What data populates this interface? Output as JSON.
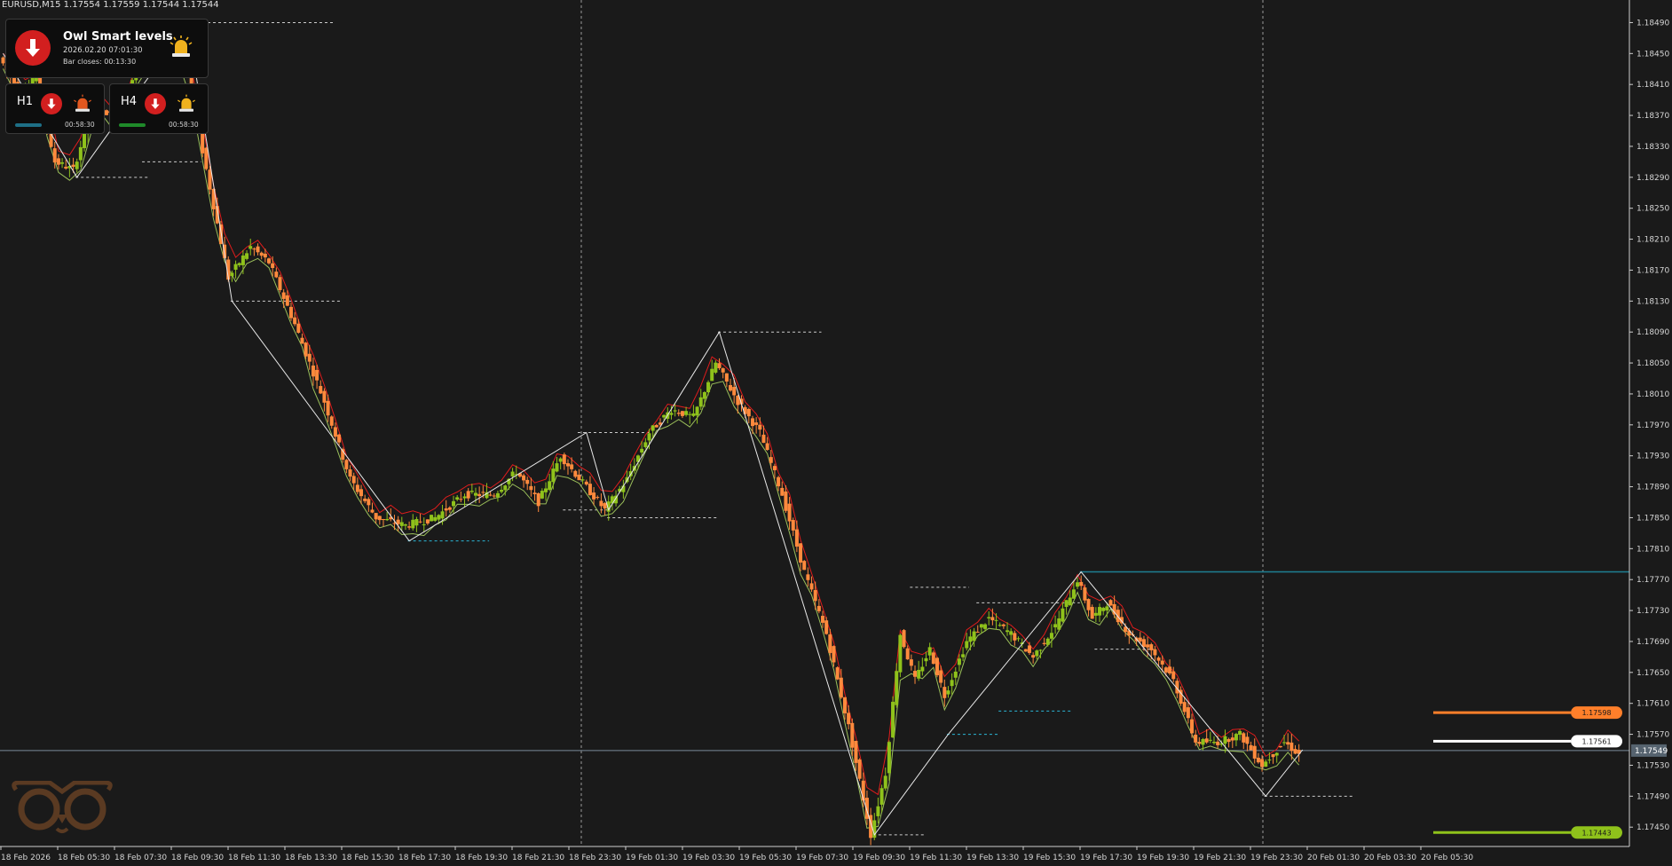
{
  "symbol_line": "EURUSD,M15  1.17554 1.17559 1.17544 1.17544",
  "panel": {
    "title": "Owl Smart levels",
    "datetime": "2026.02.20 07:01:30",
    "bar_closes": "Bar closes: 00:13:30",
    "direction": "down",
    "timeframes": [
      {
        "label": "H1",
        "timer": "00:58:30",
        "bar_color": "#1e6f86"
      },
      {
        "label": "H4",
        "timer": "00:58:30",
        "bar_color": "#1f8a2a"
      }
    ]
  },
  "colors": {
    "background": "#1a1a1a",
    "bull_candle": "#8fc21b",
    "bear_candle": "#ff8a3d",
    "zigzag": "#e8e8e8",
    "upper_envelope": "#e01c1c",
    "lower_envelope": "#9bbf5a",
    "level_dash": "#cccccc",
    "level_cyan": "#2bb6d6",
    "level_orange": "#ff7f2a",
    "level_white": "#ffffff",
    "level_green": "#8fc21b",
    "current_price": "#7a8a99"
  },
  "chart_data": {
    "type": "candlestick",
    "symbol": "EURUSD",
    "timeframe": "M15",
    "ylim": [
      1.17425,
      1.1851
    ],
    "y_ticks": [
      "1.18490",
      "1.18450",
      "1.18410",
      "1.18370",
      "1.18330",
      "1.18290",
      "1.18250",
      "1.18210",
      "1.18170",
      "1.18130",
      "1.18090",
      "1.18050",
      "1.18010",
      "1.17970",
      "1.17930",
      "1.17890",
      "1.17850",
      "1.17810",
      "1.17770",
      "1.17730",
      "1.17690",
      "1.17650",
      "1.17610",
      "1.17570",
      "1.17530",
      "1.17490",
      "1.17450"
    ],
    "x_ticks": [
      "18 Feb 2026",
      "18 Feb 05:30",
      "18 Feb 07:30",
      "18 Feb 09:30",
      "18 Feb 11:30",
      "18 Feb 13:30",
      "18 Feb 15:30",
      "18 Feb 17:30",
      "18 Feb 19:30",
      "18 Feb 21:30",
      "18 Feb 23:30",
      "19 Feb 01:30",
      "19 Feb 03:30",
      "19 Feb 05:30",
      "19 Feb 07:30",
      "19 Feb 09:30",
      "19 Feb 11:30",
      "19 Feb 13:30",
      "19 Feb 15:30",
      "19 Feb 17:30",
      "19 Feb 19:30",
      "19 Feb 21:30",
      "19 Feb 23:30",
      "20 Feb 01:30",
      "20 Feb 03:30",
      "20 Feb 05:30"
    ],
    "candles_per_tick": 8,
    "candle_count": 206,
    "current_price": 1.17549,
    "current_price_label": "1.17549",
    "price_path": [
      [
        0,
        1.18445
      ],
      [
        6,
        1.18395
      ],
      [
        10,
        1.1842
      ],
      [
        15,
        1.1831
      ],
      [
        20,
        1.183
      ],
      [
        26,
        1.1839
      ],
      [
        32,
        1.1836
      ],
      [
        38,
        1.1844
      ],
      [
        44,
        1.1847
      ],
      [
        50,
        1.18445
      ],
      [
        56,
        1.183
      ],
      [
        62,
        1.1816
      ],
      [
        68,
        1.182
      ],
      [
        73,
        1.1818
      ],
      [
        80,
        1.181
      ],
      [
        88,
        1.18
      ],
      [
        95,
        1.179
      ],
      [
        102,
        1.1785
      ],
      [
        110,
        1.1784
      ],
      [
        118,
        1.1785
      ],
      [
        126,
        1.1788
      ],
      [
        134,
        1.1788
      ],
      [
        140,
        1.1791
      ],
      [
        146,
        1.1787
      ],
      [
        152,
        1.1793
      ],
      [
        158,
        1.17895
      ],
      [
        164,
        1.1786
      ],
      [
        170,
        1.179
      ],
      [
        176,
        1.1796
      ],
      [
        182,
        1.1799
      ],
      [
        188,
        1.1798
      ],
      [
        194,
        1.1805
      ],
      [
        200,
        1.18
      ],
      [
        206,
        1.1796
      ],
      [
        212,
        1.1788
      ],
      [
        218,
        1.1778
      ],
      [
        224,
        1.177
      ],
      [
        230,
        1.1758
      ],
      [
        236,
        1.1744
      ],
      [
        240,
        1.1752
      ],
      [
        244,
        1.177
      ],
      [
        248,
        1.1764
      ],
      [
        252,
        1.1768
      ],
      [
        256,
        1.1762
      ],
      [
        262,
        1.1769
      ],
      [
        268,
        1.1772
      ],
      [
        274,
        1.177
      ],
      [
        280,
        1.1767
      ],
      [
        286,
        1.1771
      ],
      [
        292,
        1.1777
      ],
      [
        296,
        1.1772
      ],
      [
        300,
        1.1774
      ],
      [
        306,
        1.177
      ],
      [
        312,
        1.1768
      ],
      [
        318,
        1.1764
      ],
      [
        324,
        1.1756
      ],
      [
        330,
        1.1756
      ],
      [
        336,
        1.1757
      ],
      [
        342,
        1.1753
      ],
      [
        348,
        1.1756
      ],
      [
        352,
        1.17544
      ]
    ],
    "zigzag": [
      [
        1.1845,
        0
      ],
      [
        1.1829,
        20
      ],
      [
        1.1849,
        50
      ],
      [
        1.1813,
        62
      ],
      [
        1.1782,
        110
      ],
      [
        1.1796,
        158
      ],
      [
        1.1786,
        164
      ],
      [
        1.1809,
        194
      ],
      [
        1.1744,
        236
      ],
      [
        1.1757,
        256
      ],
      [
        1.1778,
        292
      ],
      [
        1.1749,
        342
      ],
      [
        1.1755,
        352
      ]
    ],
    "levels": [
      {
        "price": 1.1849,
        "x0": 50,
        "x1": 90,
        "style": "dash",
        "color": "#cccccc"
      },
      {
        "price": 1.1829,
        "x0": 20,
        "x1": 40,
        "style": "dash",
        "color": "#cccccc"
      },
      {
        "price": 1.1831,
        "x0": 38,
        "x1": 54,
        "style": "dash",
        "color": "#cccccc"
      },
      {
        "price": 1.1813,
        "x0": 62,
        "x1": 92,
        "style": "dash",
        "color": "#cccccc"
      },
      {
        "price": 1.1782,
        "x0": 110,
        "x1": 132,
        "style": "dash",
        "color": "#2bb6d6"
      },
      {
        "price": 1.1796,
        "x0": 156,
        "x1": 176,
        "style": "dash",
        "color": "#cccccc"
      },
      {
        "price": 1.1786,
        "x0": 152,
        "x1": 164,
        "style": "dash",
        "color": "#cccccc"
      },
      {
        "price": 1.1785,
        "x0": 164,
        "x1": 194,
        "style": "dash",
        "color": "#cccccc"
      },
      {
        "price": 1.1809,
        "x0": 194,
        "x1": 222,
        "style": "dash",
        "color": "#cccccc"
      },
      {
        "price": 1.1744,
        "x0": 236,
        "x1": 250,
        "style": "dash",
        "color": "#cccccc"
      },
      {
        "price": 1.1776,
        "x0": 246,
        "x1": 262,
        "style": "dash",
        "color": "#cccccc"
      },
      {
        "price": 1.1774,
        "x0": 264,
        "x1": 292,
        "style": "dash",
        "color": "#cccccc"
      },
      {
        "price": 1.1757,
        "x0": 256,
        "x1": 270,
        "style": "dash",
        "color": "#2bb6d6"
      },
      {
        "price": 1.176,
        "x0": 270,
        "x1": 290,
        "style": "dash",
        "color": "#2bb6d6"
      },
      {
        "price": 1.1768,
        "x0": 296,
        "x1": 312,
        "style": "dash",
        "color": "#cccccc"
      },
      {
        "price": 1.1749,
        "x0": 342,
        "x1": 366,
        "style": "dash",
        "color": "#cccccc"
      }
    ],
    "right_levels": [
      {
        "price": 1.17598,
        "label": "1.17598",
        "color": "#ff7f2a",
        "text_color": "#1a1a1a"
      },
      {
        "price": 1.17561,
        "label": "1.17561",
        "color": "#ffffff",
        "text_color": "#1a1a1a"
      },
      {
        "price": 1.17443,
        "label": "1.17443",
        "color": "#8fc21b",
        "text_color": "#1a1a1a"
      }
    ],
    "resistance_line": {
      "price": 1.1778,
      "color": "#1e7f93"
    },
    "vertical_separators": [
      10,
      44
    ]
  }
}
